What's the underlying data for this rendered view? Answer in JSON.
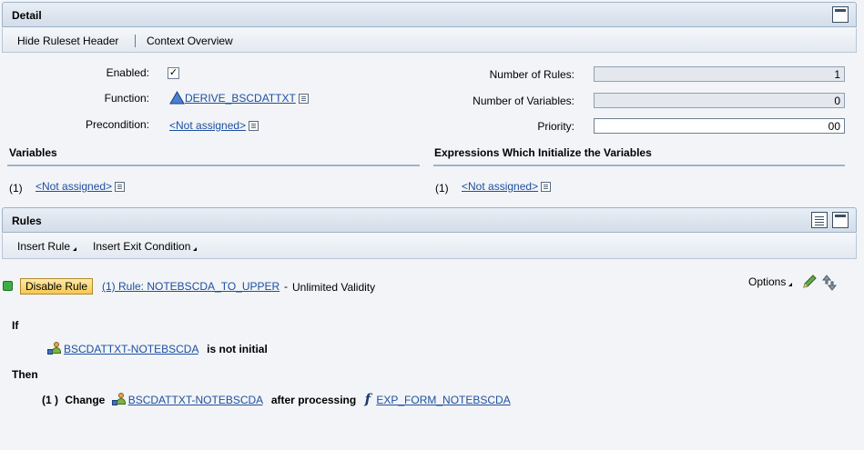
{
  "detail": {
    "title": "Detail",
    "toolbar": {
      "hide_header": "Hide Ruleset Header",
      "context_overview": "Context Overview"
    },
    "fields": {
      "enabled_label": "Enabled:",
      "enabled_checked": true,
      "enabled_mark": "✓",
      "function_label": "Function:",
      "function_value": "DERIVE_BSCDATTXT",
      "precondition_label": "Precondition:",
      "precondition_value": "<Not assigned>",
      "num_rules_label": "Number of Rules:",
      "num_rules_value": "1",
      "num_vars_label": "Number of Variables:",
      "num_vars_value": "0",
      "priority_label": "Priority:",
      "priority_value": "00"
    },
    "variables": {
      "title": "Variables",
      "index": "(1)",
      "value": "<Not assigned>"
    },
    "expressions": {
      "title": "Expressions Which Initialize the Variables",
      "index": "(1)",
      "value": "<Not assigned>"
    }
  },
  "rules": {
    "title": "Rules",
    "toolbar": {
      "insert_rule": "Insert Rule",
      "insert_exit": "Insert Exit Condition"
    },
    "rule": {
      "disable_label": "Disable Rule",
      "link": "(1) Rule: NOTEBSCDA_TO_UPPER",
      "dash": "-",
      "validity": "Unlimited Validity",
      "options": "Options",
      "if_label": "If",
      "if_attr": "BSCDATTXT-NOTEBSCDA",
      "if_cond": "is not initial",
      "then_label": "Then",
      "then_index": "(1 )",
      "then_change": "Change",
      "then_attr": "BSCDATTXT-NOTEBSCDA",
      "then_after": "after processing",
      "then_expr": "EXP_FORM_NOTEBSCDA"
    }
  },
  "colors": {
    "link": "#1e4fa0",
    "status": "#3cb043",
    "button": "#f7c84f"
  }
}
